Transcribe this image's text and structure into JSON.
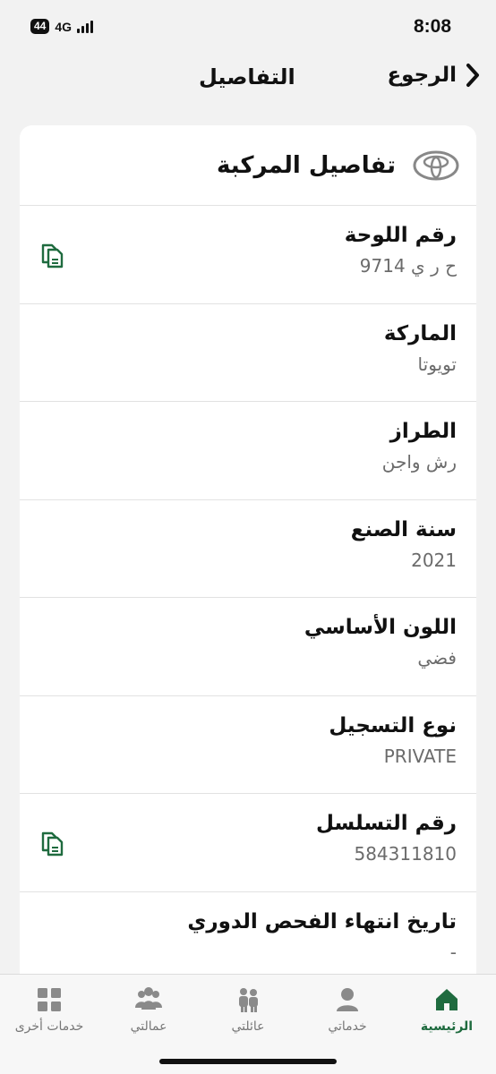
{
  "status": {
    "time": "8:08",
    "network": "4G",
    "battery": "44"
  },
  "nav": {
    "back_label": "الرجوع",
    "title": "التفاصيل"
  },
  "card": {
    "title": "تفاصيل المركبة",
    "rows": [
      {
        "label": "رقم اللوحة",
        "value": "ح ر ي 9714"
      },
      {
        "label": "الماركة",
        "value": "تويوتا"
      },
      {
        "label": "الطراز",
        "value": "رش  واجن"
      },
      {
        "label": "سنة الصنع",
        "value": "2021"
      },
      {
        "label": "اللون الأساسي",
        "value": "فضي"
      },
      {
        "label": "نوع التسجيل",
        "value": "PRIVATE"
      },
      {
        "label": "رقم التسلسل",
        "value": "584311810"
      },
      {
        "label": "تاريخ انتهاء الفحص الدوري",
        "value": "-"
      }
    ]
  },
  "tabs": [
    {
      "label": "الرئيسية",
      "icon": "home-icon",
      "active": true
    },
    {
      "label": "خدماتي",
      "icon": "person-icon"
    },
    {
      "label": "عائلتي",
      "icon": "family-icon"
    },
    {
      "label": "عمالتي",
      "icon": "workers-icon"
    },
    {
      "label": "خدمات أخرى",
      "icon": "grid-icon"
    }
  ],
  "colors": {
    "accent": "#1f6b3f",
    "inactive": "#8a8a8a",
    "background": "#f2f2f2"
  }
}
